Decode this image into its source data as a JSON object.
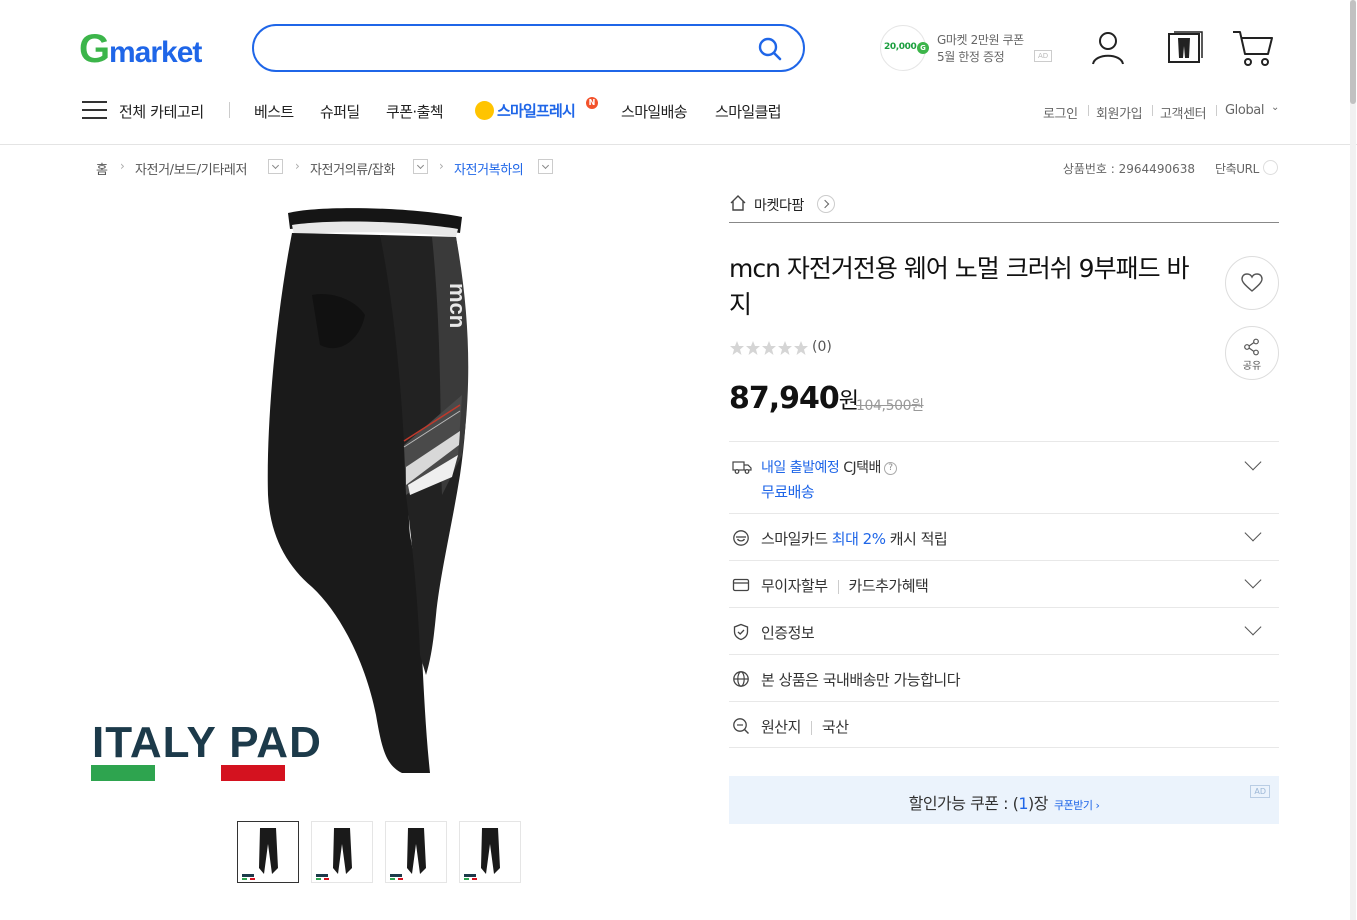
{
  "header": {
    "logo_text": "Gmarket",
    "search_placeholder": "",
    "ad_coupon": {
      "amount": "20,000",
      "line1": "G마켓 2만원 쿠폰",
      "line2": "5월 한정 증정",
      "ad_badge": "AD"
    }
  },
  "gnb": {
    "all_categories": "전체 카테고리",
    "items": [
      "베스트",
      "슈퍼딜",
      "쿠폰·출첵",
      "스마일배송",
      "스마일클럽"
    ],
    "smile_fresh": "스마일프레시",
    "smile_fresh_badge": "N",
    "util": [
      "로그인",
      "회원가입",
      "고객센터",
      "Global"
    ]
  },
  "breadcrumb": {
    "items": [
      "홈",
      "자전거/보드/기타레저",
      "자전거의류/잡화",
      "자전거복하의"
    ]
  },
  "product_no": "상품번호 : 2964490638",
  "short_url": "단축URL",
  "main_image": {
    "badge_text": "ITALY PAD",
    "brand_mark": "mcn"
  },
  "seller": {
    "name": "마켓다팜"
  },
  "product": {
    "title": "mcn 자전거전용 웨어 노멀 크러쉬 9부패드 바지",
    "rating": 0,
    "review_count": "(0)",
    "price": "87,940",
    "price_unit": "원",
    "original_price": "104,500원",
    "share_label": "공유"
  },
  "info_rows": {
    "shipping": {
      "tomorrow": "내일 출발예정",
      "carrier": "CJ택배",
      "free": "무료배송"
    },
    "smilecard": {
      "pre": "스마일카드",
      "highlight": "최대 2%",
      "post": "캐시 적립"
    },
    "installment": {
      "a": "무이자할부",
      "b": "카드추가혜택"
    },
    "cert": "인증정보",
    "domestic": "본 상품은 국내배송만 가능합니다",
    "origin": {
      "label": "원산지",
      "value": "국산"
    }
  },
  "coupon": {
    "pre": "할인가능 쿠폰 : (",
    "count": "1",
    "post": ")장",
    "get": "쿠폰받기 ›",
    "ad_badge": "AD"
  },
  "colors": {
    "brand_blue": "#1f66e8",
    "logo_green": "#3cb54a",
    "logo_blue": "#1f66e8",
    "coupon_bg": "#ebf3fc",
    "smile_yellow": "#ffc400"
  }
}
